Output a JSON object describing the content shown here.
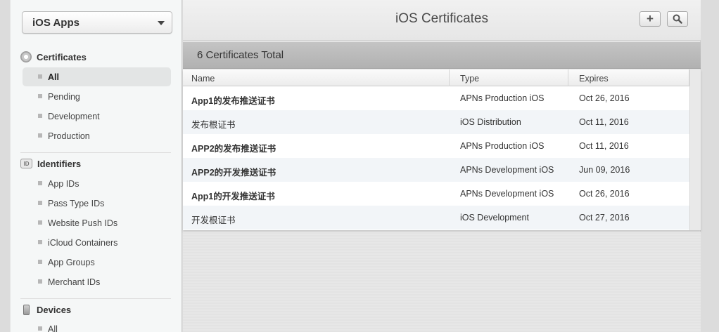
{
  "app_selector": {
    "value": "iOS Apps"
  },
  "sidebar": {
    "certificates": {
      "title": "Certificates",
      "items": [
        "All",
        "Pending",
        "Development",
        "Production"
      ]
    },
    "identifiers": {
      "title": "Identifiers",
      "icon_text": "ID",
      "items": [
        "App IDs",
        "Pass Type IDs",
        "Website Push IDs",
        "iCloud Containers",
        "App Groups",
        "Merchant IDs"
      ]
    },
    "devices": {
      "title": "Devices",
      "items": [
        "All"
      ]
    }
  },
  "header": {
    "title": "iOS Certificates",
    "add_label": "+"
  },
  "summary": {
    "text": "6 Certificates Total"
  },
  "table": {
    "columns": [
      "Name",
      "Type",
      "Expires"
    ],
    "rows": [
      {
        "name": "App1的发布推送证书",
        "type": "APNs Production iOS",
        "expires": "Oct 26, 2016"
      },
      {
        "name": "发布根证书",
        "type": "iOS Distribution",
        "expires": "Oct 11, 2016"
      },
      {
        "name": "APP2的发布推送证书",
        "type": "APNs Production iOS",
        "expires": "Oct 11, 2016"
      },
      {
        "name": "APP2的开发推送证书",
        "type": "APNs Development iOS",
        "expires": "Jun 09, 2016"
      },
      {
        "name": "App1的开发推送证书",
        "type": "APNs Development iOS",
        "expires": "Oct 26, 2016"
      },
      {
        "name": "开发根证书",
        "type": "iOS Development",
        "expires": "Oct 27, 2016"
      }
    ]
  }
}
